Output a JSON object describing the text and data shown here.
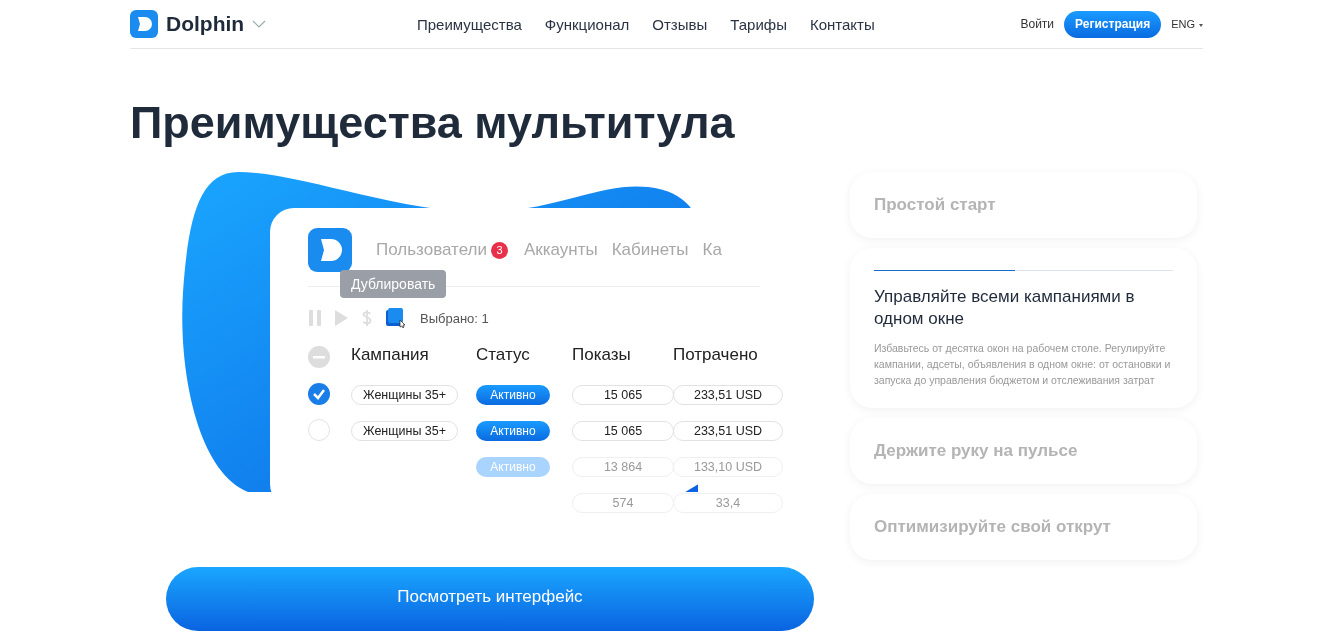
{
  "header": {
    "brand": "Dolphin",
    "nav": [
      {
        "label": "Преимущества"
      },
      {
        "label": "Функционал"
      },
      {
        "label": "Отзывы"
      },
      {
        "label": "Тарифы"
      },
      {
        "label": "Контакты"
      }
    ],
    "login": "Войти",
    "register": "Регистрация",
    "language": "ENG"
  },
  "title": "Преимущества мультитула",
  "mockup": {
    "tabs": [
      {
        "label": "Пользователи",
        "badge": "3"
      },
      {
        "label": "Аккаунты"
      },
      {
        "label": "Кабинеты"
      },
      {
        "label": "Ка"
      }
    ],
    "tooltip": "Дублировать",
    "selected_count": "Выбрано: 1",
    "columns": [
      "Кампания",
      "Статус",
      "Показы",
      "Потрачено"
    ],
    "rows": [
      {
        "checked": true,
        "faded": false,
        "campaign": "Женщины 35+",
        "status": "Активно",
        "impressions": "15 065",
        "spent": "233,51 USD"
      },
      {
        "checked": false,
        "faded": false,
        "campaign": "Женщины 35+",
        "status": "Активно",
        "impressions": "15 065",
        "spent": "233,51 USD"
      },
      {
        "faded": true,
        "status": "Активно",
        "impressions": "13 864",
        "spent": "133,10 USD"
      },
      {
        "faded": true,
        "impressions": "574",
        "spent": "33,4"
      }
    ]
  },
  "cta": "Посмотреть интерфейс",
  "features": [
    {
      "title": "Простой старт",
      "expanded": false
    },
    {
      "title": "Управляйте всеми кампаниями в одном окне",
      "expanded": true,
      "level": 0.47,
      "text": "Избавьтесь от десятка окон на рабочем столе. Регулируйте кампании, адсеты, объявления в одном окне: от остановки и запуска до управления бюджетом и отслеживания затрат"
    },
    {
      "title": "Держите руку на пульсе",
      "expanded": false
    },
    {
      "title": "Оптимизируйте свой открут",
      "expanded": false
    }
  ]
}
